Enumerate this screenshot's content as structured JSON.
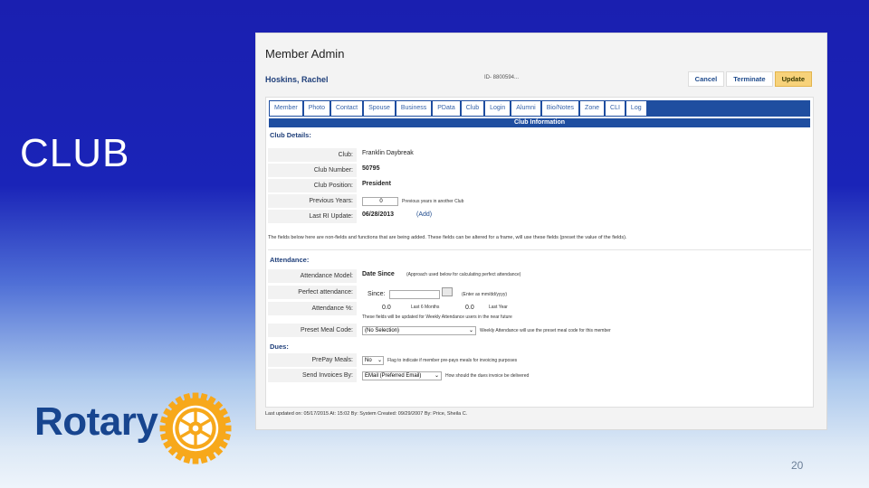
{
  "slide": {
    "title": "CLUB",
    "page_number": "20",
    "logo_text": "Rotary"
  },
  "app": {
    "title": "Member Admin",
    "member_name": "Hoskins, Rachel",
    "id_text": "ID- 8800594...",
    "buttons": {
      "cancel": "Cancel",
      "terminate": "Terminate",
      "update": "Update"
    },
    "tabs": [
      "Member",
      "Photo",
      "Contact",
      "Spouse",
      "Business",
      "PData",
      "Club",
      "Login",
      "Alumni",
      "Bio/Notes",
      "Zone",
      "CLI",
      "Log"
    ],
    "panel_title": "Club Information",
    "club_details": {
      "heading": "Club Details:",
      "rows": [
        {
          "label": "Club:",
          "value": "Franklin Daybreak"
        },
        {
          "label": "Club Number:",
          "value": "50795"
        },
        {
          "label": "Club Position:",
          "value": "President"
        },
        {
          "label": "Previous Years:",
          "value": "0",
          "note": "Previous years in another Club"
        },
        {
          "label": "Last RI Update:",
          "value": "06/28/2013",
          "link": "(Add)"
        }
      ]
    },
    "notice": "The fields below here are non-fields and functions that are being added. These fields can be altered for a frame, will use these fields (preset the value of the fields).",
    "attendance": {
      "heading": "Attendance:",
      "model_label": "Attendance Model:",
      "model_value": "Date Since",
      "model_note": "(Approach used below for calculating perfect attendance)",
      "perfect_label": "Perfect attendance:",
      "since_label": "Since:",
      "date_hint": "(Enter as mm/dd/yyyy)",
      "pct_label": "Attendance %:",
      "pct_6m": "0.0",
      "pct_6m_label": "Last 6 Months",
      "pct_year": "0.0",
      "pct_year_label": "Last Year",
      "pct_note": "These fields will be updated for Weekly Attendance users in the near future",
      "meal_label": "Preset Meal Code:",
      "meal_value": "(No Selection)",
      "meal_note": "Weekly Attendance will use the preset meal code for this member"
    },
    "dues": {
      "heading": "Dues:",
      "prepay_label": "PrePay Meals:",
      "prepay_value": "No",
      "prepay_note": "Flag to indicate if member pre-pays meals for invoicing purposes",
      "invoice_label": "Send Invoices By:",
      "invoice_value": "EMail (Preferred Email)",
      "invoice_note": "How should the dues invoice be delivered"
    },
    "footer": "Last updated on: 05/17/2015 At: 15:02 By: System  Created: 09/29/2007 By: Price, Sheila C."
  },
  "colors": {
    "bg_top": "#1a1fb0",
    "accent": "#1f4ea0",
    "rotary_blue": "#17458f",
    "rotary_gold": "#f7a81b",
    "update_button": "#f7d27a"
  }
}
